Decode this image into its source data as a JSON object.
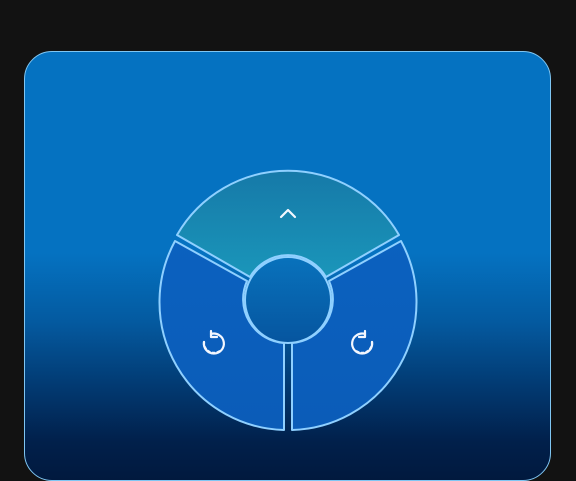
{
  "panel": {
    "accent": "#0572c1",
    "border_color": "#7fc6f3",
    "bottom_color": "#01193e"
  },
  "control": {
    "segments": [
      {
        "name": "forward-segment",
        "icon": "chevron-up-icon",
        "color": "#158fb9"
      },
      {
        "name": "rotate-left-segment",
        "icon": "rotate-left-icon",
        "color": "#0b5fbe"
      },
      {
        "name": "rotate-right-segment",
        "icon": "rotate-right-icon",
        "color": "#0b5fbe"
      }
    ],
    "center_button": {
      "name": "center-button",
      "color": "#0a6fb7"
    }
  }
}
